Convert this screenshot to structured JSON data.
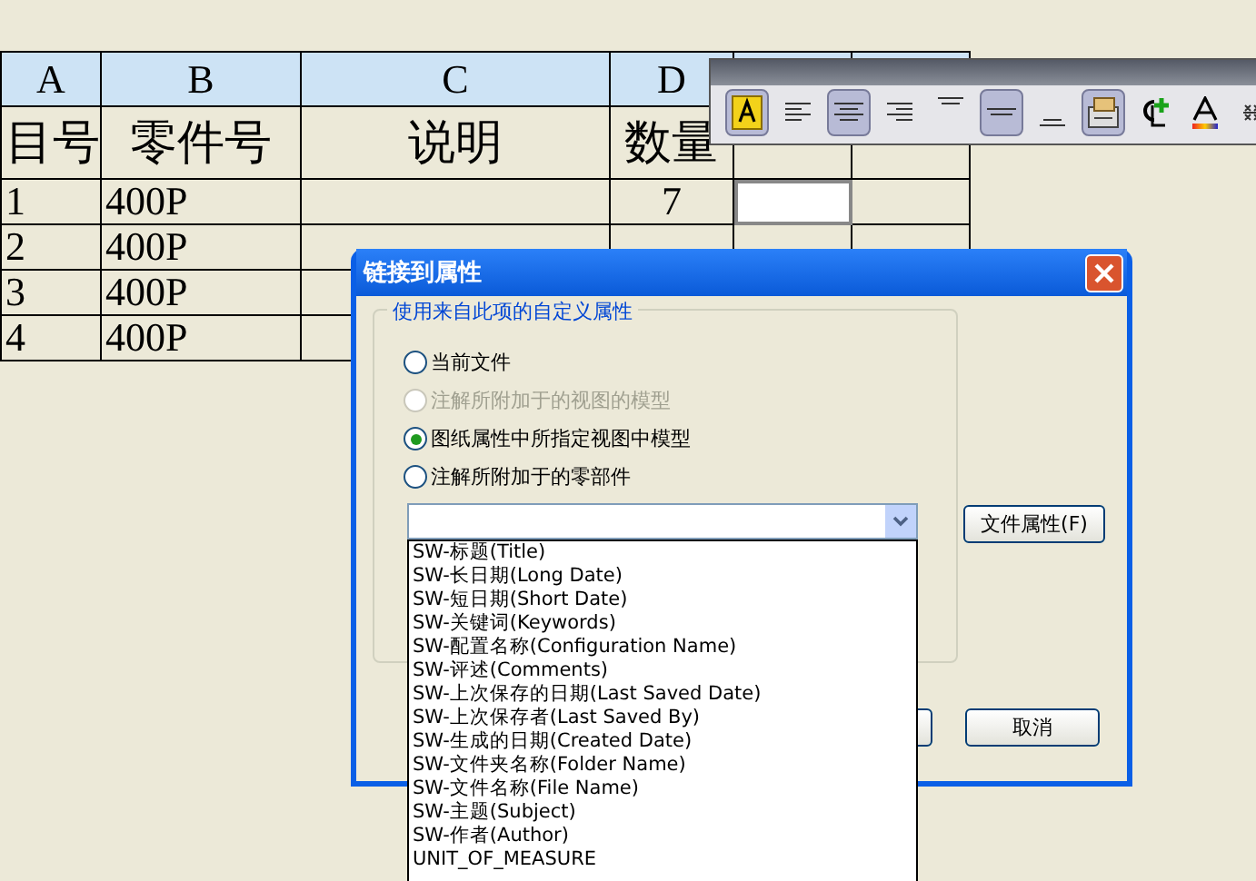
{
  "table": {
    "column_letters": [
      "A",
      "B",
      "C",
      "D"
    ],
    "headings": [
      "目号",
      "零件号",
      "说明",
      "数量"
    ],
    "rows": [
      {
        "item": "1",
        "part": "400P",
        "qty": "7",
        "active_cell": true
      },
      {
        "item": "2",
        "part": "400P"
      },
      {
        "item": "3",
        "part": "400P"
      },
      {
        "item": "4",
        "part": "400P"
      }
    ]
  },
  "toolbar": {
    "buttons": [
      {
        "kind": "font",
        "selected": true
      },
      {
        "kind": "align-left",
        "selected": false
      },
      {
        "kind": "align-center",
        "selected": true
      },
      {
        "kind": "align-right",
        "selected": false
      },
      {
        "kind": "align-top",
        "selected": false
      },
      {
        "kind": "align-middle",
        "selected": true
      },
      {
        "kind": "align-bottom",
        "selected": false
      },
      {
        "kind": "properties",
        "selected": true
      },
      {
        "kind": "link",
        "selected": false
      },
      {
        "kind": "font-color",
        "selected": false
      },
      {
        "kind": "stack",
        "selected": false
      }
    ]
  },
  "dialog": {
    "title": "链接到属性",
    "group_title": "使用来自此项的自定义属性",
    "options": [
      {
        "label": "当前文件",
        "selected": false,
        "disabled": false
      },
      {
        "label": "注解所附加于的视图的模型",
        "selected": false,
        "disabled": true
      },
      {
        "label": "图纸属性中所指定视图中模型",
        "selected": true,
        "disabled": false
      },
      {
        "label": "注解所附加于的零部件",
        "selected": false,
        "disabled": false
      }
    ],
    "property_list": [
      "SW-标题(Title)",
      "SW-长日期(Long Date)",
      "SW-短日期(Short Date)",
      "SW-关键词(Keywords)",
      "SW-配置名称(Configuration Name)",
      "SW-评述(Comments)",
      "SW-上次保存的日期(Last Saved Date)",
      "SW-上次保存者(Last Saved By)",
      "SW-生成的日期(Created Date)",
      "SW-文件夹名称(Folder Name)",
      "SW-文件名称(File Name)",
      "SW-主题(Subject)",
      "SW-作者(Author)",
      "UNIT_OF_MEASURE"
    ],
    "file_properties_button": "文件属性(F)",
    "cancel_button": "取消"
  }
}
